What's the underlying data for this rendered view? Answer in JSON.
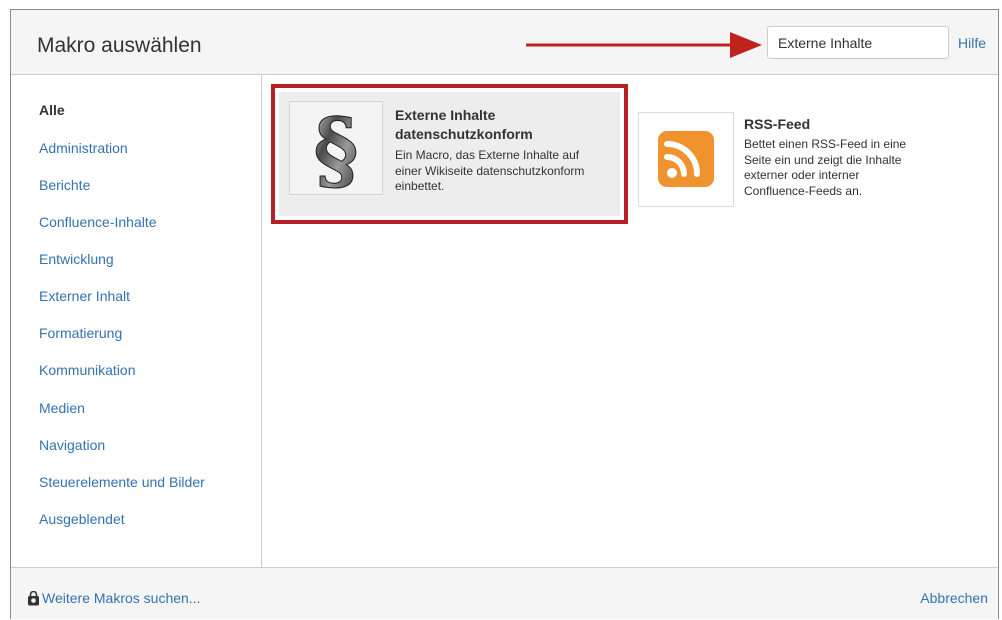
{
  "dialog": {
    "title": "Makro auswählen",
    "search": {
      "value": "Externe Inhalte",
      "placeholder": ""
    },
    "help_label": "Hilfe"
  },
  "sidebar": {
    "categories": [
      {
        "label": "Alle",
        "active": true
      },
      {
        "label": "Administration"
      },
      {
        "label": "Berichte"
      },
      {
        "label": "Confluence-Inhalte"
      },
      {
        "label": "Entwicklung"
      },
      {
        "label": "Externer Inhalt"
      },
      {
        "label": "Formatierung"
      },
      {
        "label": "Kommunikation"
      },
      {
        "label": "Medien"
      },
      {
        "label": "Navigation"
      },
      {
        "label": "Steuerelemente und Bilder"
      },
      {
        "label": "Ausgeblendet"
      }
    ]
  },
  "macros": [
    {
      "title_line1": "Externe Inhalte",
      "title_line2": "datenschutzkonform",
      "desc_lines": [
        "Ein Macro, das Externe Inhalte auf",
        "einer Wikiseite datenschutzkonform",
        "einbettet."
      ],
      "icon": "paragraph-sign-icon",
      "highlighted": true
    },
    {
      "title": "RSS-Feed",
      "desc_lines": [
        "Bettet einen RSS-Feed in eine",
        "Seite ein und zeigt die Inhalte",
        "externer oder interner",
        "Confluence-Feeds an."
      ],
      "icon": "rss-icon"
    }
  ],
  "footer": {
    "more_label": "Weitere Makros suchen...",
    "more_icon": "marketplace-bag-icon",
    "cancel_label": "Abbrechen"
  },
  "colors": {
    "link": "#3572b0",
    "highlight_border": "#b52025",
    "annotation_arrow": "#c0231e",
    "rss_orange": "#f0922e"
  }
}
